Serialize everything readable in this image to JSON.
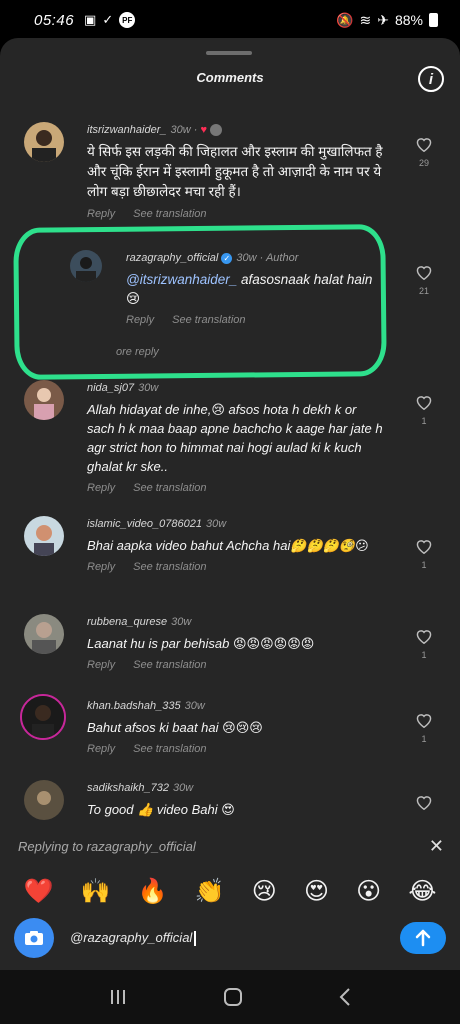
{
  "status": {
    "time": "05:46",
    "battery": "88%"
  },
  "sheet": {
    "title": "Comments"
  },
  "comments": [
    {
      "username": "itsrizwanhaider_",
      "time": "30w",
      "text": "ये सिर्फ इस लड़की की जिहालत और इस्लाम की मुखालिफत है और चूंकि ईरान में इस्लामी हुकूमत है तो आज़ादी के नाम पर ये लोग बड़ा छीछालेदर मचा रही हैं।",
      "reply": "Reply",
      "see_translation": "See translation",
      "likes": "29"
    },
    {
      "username": "razagraphy_official",
      "time": "30w",
      "author": "· Author",
      "mention": "@itsrizwanhaider_",
      "text": " afasosnaak halat hain 😢",
      "reply": "Reply",
      "see_translation": "See translation",
      "likes": "21"
    },
    {
      "username": "nida_sj07",
      "time": "30w",
      "text": "Allah hidayat de inhe,😢 afsos hota h dekh k or sach h k maa baap apne bachcho k aage har jate h agr strict hon to himmat nai hogi aulad ki k kuch ghalat kr ske..",
      "reply": "Reply",
      "see_translation": "See translation",
      "likes": "1"
    },
    {
      "username": "islamic_video_0786021",
      "time": "30w",
      "text": "Bhai aapka video bahut Achcha hai🤔🤔🤔🧐😕",
      "reply": "Reply",
      "see_translation": "See translation",
      "likes": "1"
    },
    {
      "username": "rubbena_qurese",
      "time": "30w",
      "text": "Laanat hu is par behisab 😡😡😡😡😡😡",
      "reply": "Reply",
      "see_translation": "See translation",
      "likes": "1"
    },
    {
      "username": "khan.badshah_335",
      "time": "30w",
      "text": "Bahut afsos ki baat hai 😢😢😢",
      "reply": "Reply",
      "see_translation": "See translation",
      "likes": "1"
    },
    {
      "username": "sadikshaikh_732",
      "time": "30w",
      "text": "To good 👍 video Bahi 😍"
    }
  ],
  "more_replies": "ore reply",
  "replying": {
    "text": "Replying to razagraphy_official"
  },
  "emojis": [
    "❤️",
    "🙌",
    "🔥",
    "👏",
    "😢",
    "😍",
    "😮",
    "😂"
  ],
  "composer": {
    "value": "@razagraphy_official"
  },
  "colors": {
    "highlight": "#2ee08c",
    "accent": "#1d8ef2",
    "like_red": "#ff2d55"
  }
}
